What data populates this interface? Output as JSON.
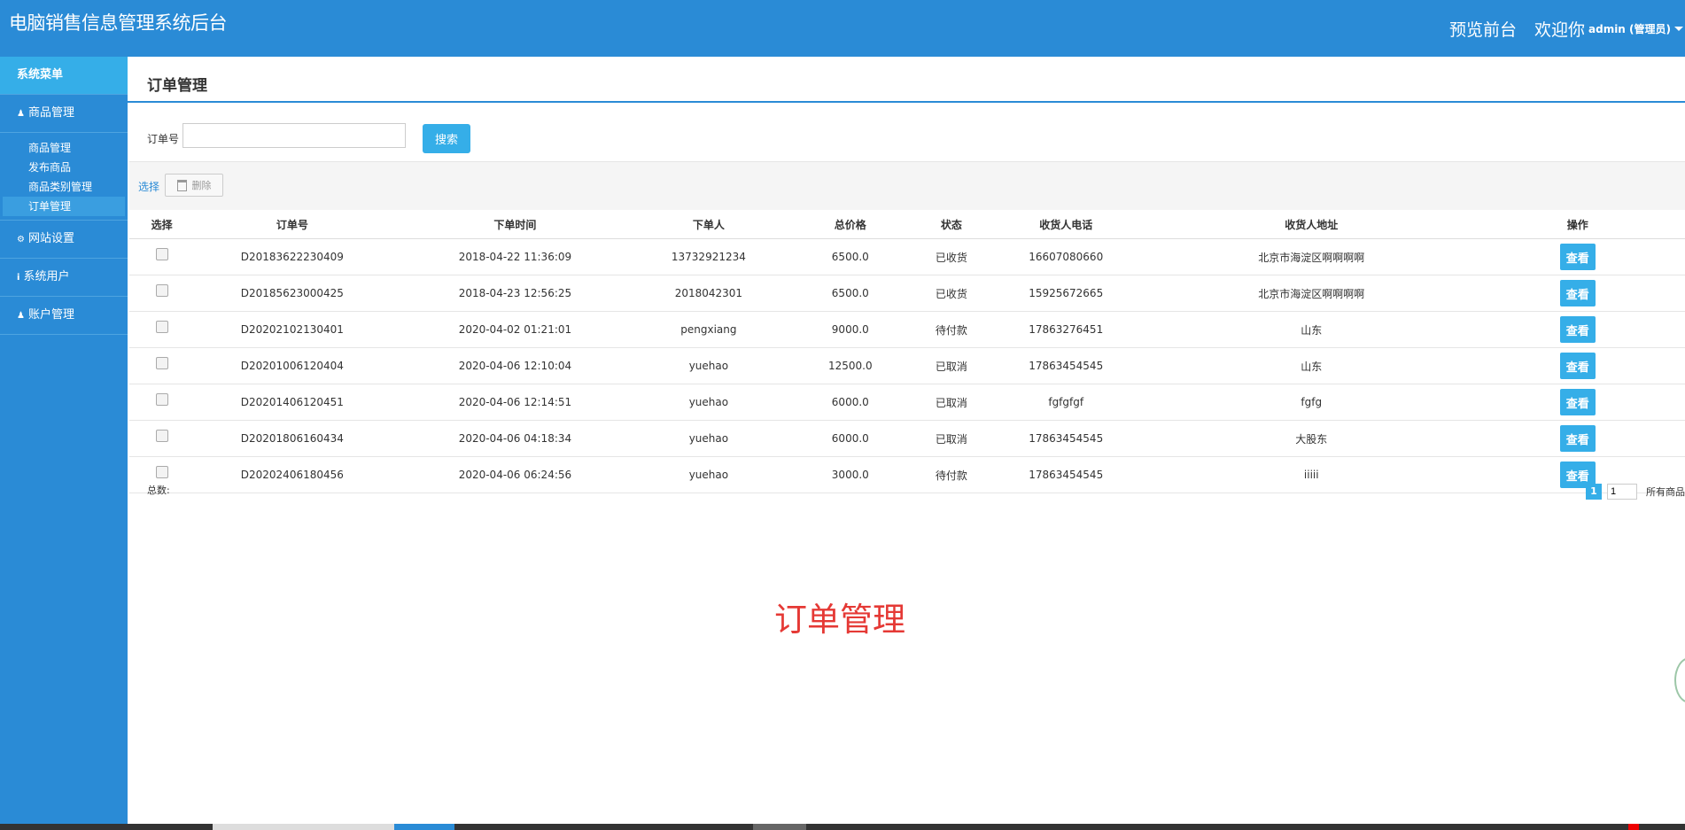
{
  "header": {
    "title": "电脑销售信息管理系统后台",
    "preview": "预览前台",
    "welcome": "欢迎你",
    "user": "admin (管理员)"
  },
  "sidebar": {
    "title": "系统菜单",
    "groups": [
      {
        "label": "商品管理",
        "icon": "user-icon"
      },
      {
        "label": "网站设置",
        "icon": "gear-icon"
      },
      {
        "label": "系统用户",
        "icon": "info-icon"
      },
      {
        "label": "账户管理",
        "icon": "user-icon"
      }
    ],
    "sub_items": [
      "商品管理",
      "发布商品",
      "商品类别管理",
      "订单管理"
    ]
  },
  "page": {
    "title": "订单管理",
    "search_label": "订单号",
    "search_value": "",
    "search_button": "搜索",
    "select_link": "选择",
    "delete_button": "删除",
    "total_label": "总数:",
    "pager_current": "1",
    "pager_input": "1",
    "pager_text": "所有商品",
    "watermark": "订单管理"
  },
  "table": {
    "headers": [
      "选择",
      "订单号",
      "下单时间",
      "下单人",
      "总价格",
      "状态",
      "收货人电话",
      "收货人地址",
      "操作"
    ],
    "view_label": "查看",
    "rows": [
      [
        "D20183622230409",
        "2018-04-22 11:36:09",
        "13732921234",
        "6500.0",
        "已收货",
        "16607080660",
        "北京市海淀区啊啊啊啊"
      ],
      [
        "D20185623000425",
        "2018-04-23 12:56:25",
        "2018042301",
        "6500.0",
        "已收货",
        "15925672665",
        "北京市海淀区啊啊啊啊"
      ],
      [
        "D20202102130401",
        "2020-04-02 01:21:01",
        "pengxiang",
        "9000.0",
        "待付款",
        "17863276451",
        "山东"
      ],
      [
        "D20201006120404",
        "2020-04-06 12:10:04",
        "yuehao",
        "12500.0",
        "已取消",
        "17863454545",
        "山东"
      ],
      [
        "D20201406120451",
        "2020-04-06 12:14:51",
        "yuehao",
        "6000.0",
        "已取消",
        "fgfgfgf",
        "fgfg"
      ],
      [
        "D20201806160434",
        "2020-04-06 04:18:34",
        "yuehao",
        "6000.0",
        "已取消",
        "17863454545",
        "大股东"
      ],
      [
        "D20202406180456",
        "2020-04-06 06:24:56",
        "yuehao",
        "3000.0",
        "待付款",
        "17863454545",
        "iiiii"
      ]
    ]
  }
}
